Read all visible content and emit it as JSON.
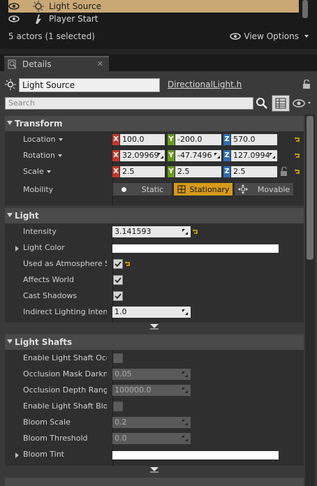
{
  "outliner": {
    "items": [
      {
        "label": "Light Source",
        "selected": true
      },
      {
        "label": "Player Start",
        "selected": false
      }
    ],
    "count_text": "5 actors (1 selected)",
    "view_options": "View Options"
  },
  "tab": {
    "label": "Details"
  },
  "details": {
    "name_value": "Light Source",
    "class_link": "DirectionalLight.h",
    "search_placeholder": "Search"
  },
  "transform": {
    "header": "Transform",
    "location": {
      "label": "Location",
      "x": "100.0",
      "y": "-200.0",
      "z": "570.0"
    },
    "rotation": {
      "label": "Rotation",
      "x": "32.09969",
      "y": "-47.7496",
      "z": "127.0994"
    },
    "scale": {
      "label": "Scale",
      "x": "2.5",
      "y": "2.5",
      "z": "2.5"
    },
    "mobility": {
      "label": "Mobility",
      "options": [
        "Static",
        "Stationary",
        "Movable"
      ],
      "selected": "Stationary"
    },
    "axis_letters": {
      "x": "X",
      "y": "Y",
      "z": "Z"
    }
  },
  "light": {
    "header": "Light",
    "intensity": {
      "label": "Intensity",
      "value": "3.141593"
    },
    "light_color": {
      "label": "Light Color"
    },
    "atmosphere": {
      "label": "Used as Atmosphere Sun",
      "checked": true
    },
    "affects_world": {
      "label": "Affects World",
      "checked": true
    },
    "cast_shadows": {
      "label": "Cast Shadows",
      "checked": true
    },
    "indirect": {
      "label": "Indirect Lighting Intensity",
      "value": "1.0"
    }
  },
  "light_shafts": {
    "header": "Light Shafts",
    "enable_occlusion": {
      "label": "Enable Light Shaft Occlusion",
      "checked": false
    },
    "mask_darkness": {
      "label": "Occlusion Mask Darkness",
      "value": "0.05"
    },
    "depth_range": {
      "label": "Occlusion Depth Range",
      "value": "100000.0"
    },
    "enable_bloom": {
      "label": "Enable Light Shaft Bloom",
      "checked": false
    },
    "bloom_scale": {
      "label": "Bloom Scale",
      "value": "0.2"
    },
    "bloom_threshold": {
      "label": "Bloom Threshold",
      "value": "0.0"
    },
    "bloom_tint": {
      "label": "Bloom Tint"
    }
  },
  "colors": {
    "selected_row": "#c9a875",
    "active_mobility": "#d79a1a",
    "axis_x": "#c0392b",
    "axis_y": "#6a9a1f",
    "axis_z": "#2f6db3"
  }
}
